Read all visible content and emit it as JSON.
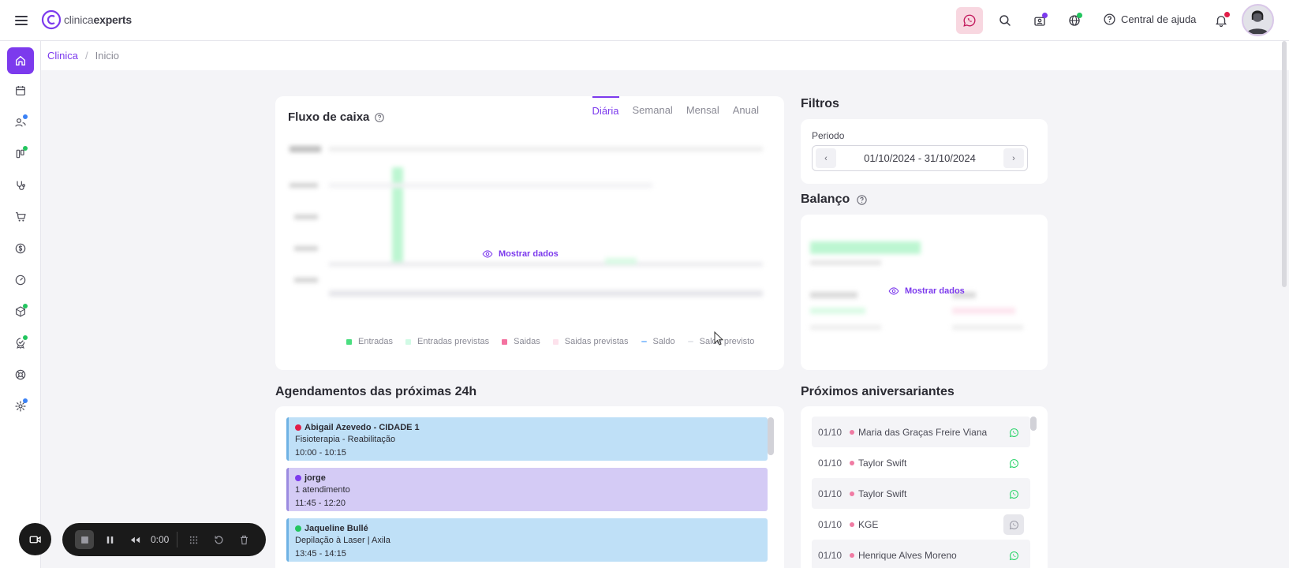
{
  "header": {
    "logo_light": "clinica",
    "logo_bold": "experts",
    "help_label": "Central de ajuda"
  },
  "breadcrumb": {
    "root": "Clinica",
    "separator": "/",
    "current": "Inicio"
  },
  "colors": {
    "accent": "#7c3aed",
    "whatsapp": "#25d366",
    "notif_red": "#e11d48"
  },
  "sidebar": {
    "items": [
      {
        "icon": "home-icon"
      },
      {
        "icon": "calendar-icon"
      },
      {
        "icon": "users-icon"
      },
      {
        "icon": "kanban-icon"
      },
      {
        "icon": "stethoscope-icon"
      },
      {
        "icon": "cart-icon"
      },
      {
        "icon": "dollar-icon"
      },
      {
        "icon": "gauge-icon"
      },
      {
        "icon": "box-icon"
      },
      {
        "icon": "badge-icon"
      },
      {
        "icon": "lifebuoy-icon"
      },
      {
        "icon": "gear-icon"
      }
    ]
  },
  "cashflow": {
    "title": "Fluxo de caixa",
    "tabs": [
      "Diária",
      "Semanal",
      "Mensal",
      "Anual"
    ],
    "active_tab": "Diária",
    "reveal_label": "Mostrar dados",
    "legend": [
      {
        "label": "Entradas",
        "color": "#4ade80"
      },
      {
        "label": "Entradas previstas",
        "color": "#d1fae5"
      },
      {
        "label": "Saidas",
        "color": "#f472a0"
      },
      {
        "label": "Saidas previstas",
        "color": "#fde2ec"
      },
      {
        "label": "Saldo",
        "color": "#93c5fd"
      },
      {
        "label": "Saldo previsto",
        "color": "#e5e7eb"
      }
    ]
  },
  "filters": {
    "title": "Filtros",
    "period_label": "Periodo",
    "period_value": "01/10/2024 - 31/10/2024"
  },
  "balance": {
    "title": "Balanço",
    "reveal_label": "Mostrar dados"
  },
  "appointments": {
    "title": "Agendamentos das próximas 24h",
    "items": [
      {
        "name": "Abigail Azevedo - CIDADE 1",
        "service": "Fisioterapia - Reabilitação",
        "time": "10:00 - 10:15",
        "bg": "#bfe0f7",
        "border": "#6fb2e4",
        "dot": "#e11d48"
      },
      {
        "name": "jorge",
        "service": "1 atendimento",
        "time": "11:45 - 12:20",
        "bg": "#d4cbf5",
        "border": "#9b8be0",
        "dot": "#7c3aed"
      },
      {
        "name": "Jaqueline Bullé",
        "service": "Depilação à Laser | Axila",
        "time": "13:45 - 14:15",
        "bg": "#bfe0f7",
        "border": "#6fb2e4",
        "dot": "#22c55e"
      }
    ]
  },
  "birthdays": {
    "title": "Próximos aniversariantes",
    "items": [
      {
        "date": "01/10",
        "name": "Maria das Graças Freire Viana",
        "wa": true
      },
      {
        "date": "01/10",
        "name": "Taylor Swift",
        "wa": true
      },
      {
        "date": "01/10",
        "name": "Taylor Swift",
        "wa": true
      },
      {
        "date": "01/10",
        "name": "KGE",
        "wa": false
      },
      {
        "date": "01/10",
        "name": "Henrique Alves Moreno",
        "wa": true
      }
    ]
  },
  "recorder": {
    "timer": "0:00"
  }
}
